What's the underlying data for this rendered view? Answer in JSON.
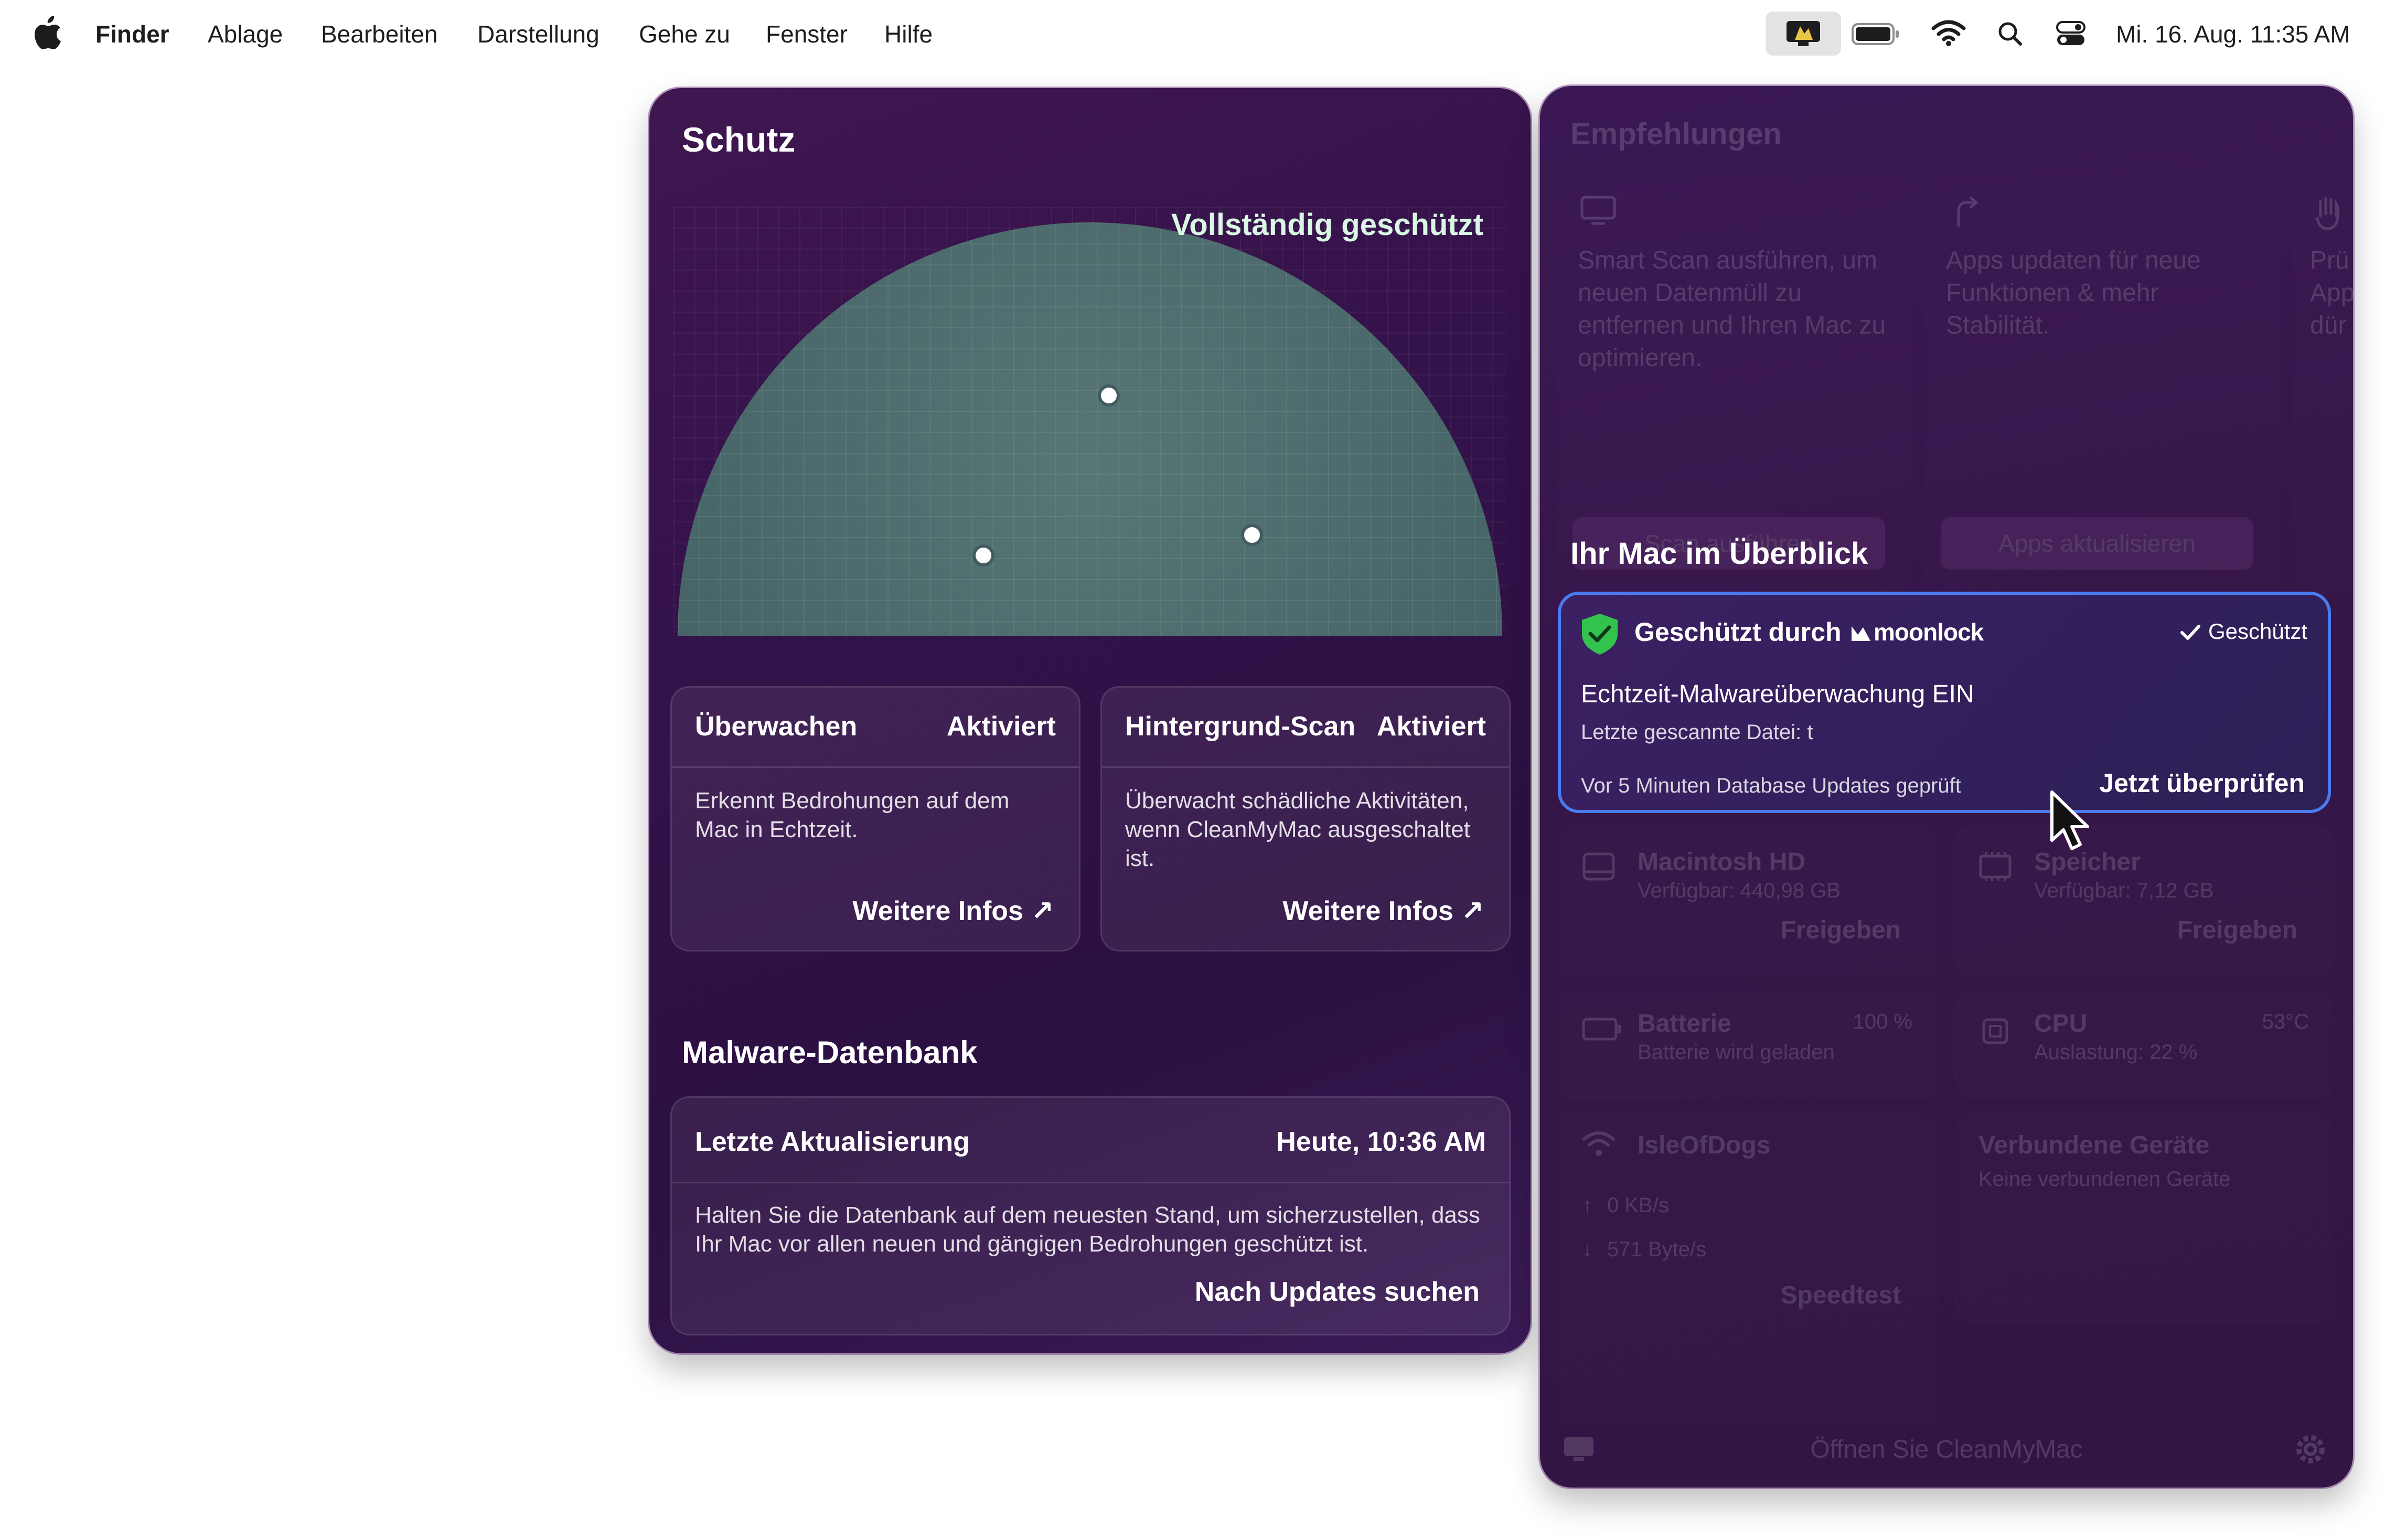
{
  "menubar": {
    "app_name": "Finder",
    "menus": [
      "Ablage",
      "Bearbeiten",
      "Darstellung",
      "Gehe zu",
      "Fenster",
      "Hilfe"
    ],
    "datetime": "Mi. 16. Aug.  11:35 AM",
    "icons": [
      "apple-logo",
      "cleanmymac-tray-icon",
      "battery-icon",
      "wifi-icon",
      "search-icon",
      "control-center-icon"
    ]
  },
  "left": {
    "title": "Schutz",
    "status": "Vollständig geschützt",
    "cards": [
      {
        "title": "Überwachen",
        "state": "Aktiviert",
        "desc": "Erkennt Bedrohungen auf dem Mac in Echtzeit.",
        "link": "Weitere Infos ↗"
      },
      {
        "title": "Hintergrund-Scan",
        "state": "Aktiviert",
        "desc": "Überwacht schädliche Aktivitäten, wenn CleanMyMac ausgeschaltet ist.",
        "link": "Weitere Infos ↗"
      }
    ],
    "db": {
      "heading": "Malware-Datenbank",
      "label": "Letzte Aktualisierung",
      "value": "Heute, 10:36 AM",
      "desc": "Halten Sie die Datenbank auf dem neuesten Stand, um sicherzustellen, dass Ihr Mac vor allen neuen und gängigen Bedrohungen geschützt ist.",
      "action": "Nach Updates suchen"
    }
  },
  "right": {
    "recommendations": {
      "title": "Empfehlungen",
      "cards": [
        {
          "text": "Smart Scan ausführen, um neuen Datenmüll zu entfernen und Ihren Mac zu optimieren.",
          "button": "Scan ausführen",
          "icon": "monitor-icon"
        },
        {
          "text": "Apps updaten für neue Funktionen & mehr Stabilität.",
          "button": "Apps aktualisieren",
          "icon": "update-arrow-icon"
        },
        {
          "text": "Prü App dür",
          "button": "",
          "icon": "hand-icon"
        }
      ]
    },
    "overview_title": "Ihr Mac im Überblick",
    "protection": {
      "protected_by": "Geschützt durch",
      "brand": "moonlock",
      "badge": "Geschützt",
      "realtime": "Echtzeit-Malwareüberwachung EIN",
      "last_file": "Letzte gescannte Datei: t",
      "updates": "Vor 5 Minuten Database Updates geprüft",
      "action": "Jetzt überprüfen"
    },
    "tiles": {
      "disk": {
        "name": "Macintosh HD",
        "sub": "Verfügbar: 440,98 GB",
        "action": "Freigeben"
      },
      "memory": {
        "name": "Speicher",
        "sub": "Verfügbar: 7,12 GB",
        "action": "Freigeben"
      },
      "battery": {
        "name": "Batterie",
        "value": "100 %",
        "sub": "Batterie wird geladen"
      },
      "cpu": {
        "name": "CPU",
        "value": "53°C",
        "sub": "Auslastung: 22 %"
      },
      "network": {
        "name": "IsleOfDogs",
        "up": "0 KB/s",
        "down": "571 Byte/s",
        "action": "Speedtest"
      },
      "devices": {
        "name": "Verbundene Geräte",
        "sub": "Keine verbundenen Geräte"
      }
    },
    "footer": "Öffnen Sie CleanMyMac"
  }
}
